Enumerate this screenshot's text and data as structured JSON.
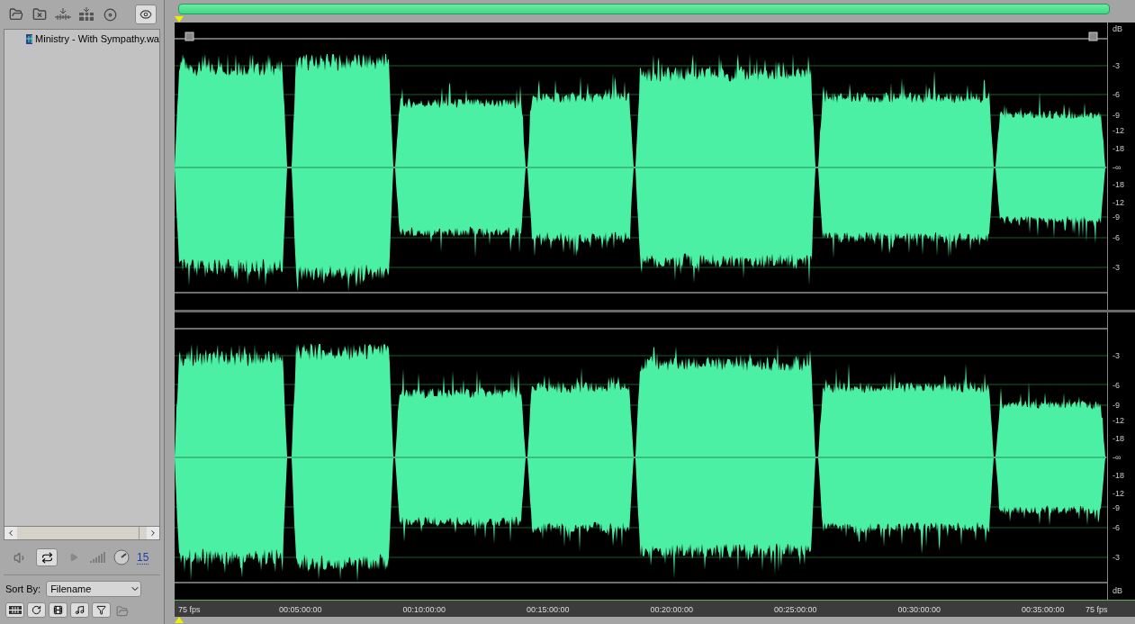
{
  "files": [
    {
      "name": "Ministry - With Sympathy.wa",
      "selected": false
    }
  ],
  "transport": {
    "volume": "15"
  },
  "sort": {
    "label": "Sort By:",
    "value": "Filename"
  },
  "channels": [
    {
      "scale": [
        "dB",
        "-3",
        "-6",
        "-9",
        "-12",
        "-18",
        "-∞",
        "-18",
        "-12",
        "-9",
        "-6",
        "-3"
      ]
    },
    {
      "scale": [
        "-3",
        "-6",
        "-9",
        "-12",
        "-18",
        "-∞",
        "-18",
        "-12",
        "-9",
        "-6",
        "-3",
        "dB"
      ]
    }
  ],
  "ruler": {
    "start": "75 fps",
    "end": "75 fps",
    "ticks": [
      "00:05:00:00",
      "00:10:00:00",
      "00:15:00:00",
      "00:20:00:00",
      "00:25:00:00",
      "00:30:00:00",
      "00:35:00:00"
    ]
  }
}
